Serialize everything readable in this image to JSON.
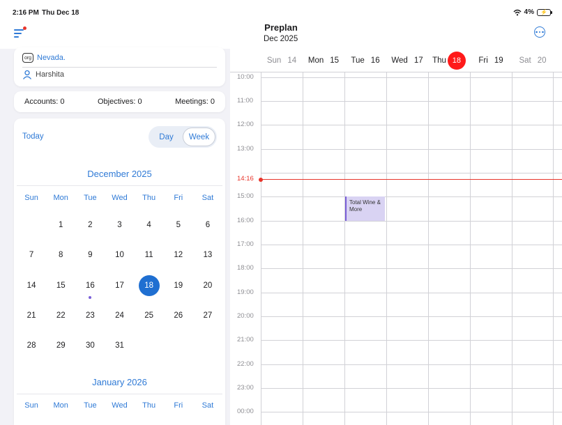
{
  "status": {
    "time": "2:16 PM",
    "date": "Thu Dec 18",
    "battery": "4%"
  },
  "nav": {
    "title": "Preplan",
    "subtitle": "Dec 2025"
  },
  "info": {
    "org": "Nevada.",
    "user": "Harshita",
    "org_icon_text": "org"
  },
  "stats": {
    "accounts": "Accounts: 0",
    "objectives": "Objectives: 0",
    "meetings": "Meetings: 0"
  },
  "calendar": {
    "today_label": "Today",
    "segment": {
      "day": "Day",
      "week": "Week",
      "selected": "Week"
    },
    "weekdays": [
      "Sun",
      "Mon",
      "Tue",
      "Wed",
      "Thu",
      "Fri",
      "Sat"
    ],
    "month1": {
      "title": "December 2025",
      "weeks": [
        [
          "",
          "1",
          "2",
          "3",
          "4",
          "5",
          "6"
        ],
        [
          "7",
          "8",
          "9",
          "10",
          "11",
          "12",
          "13"
        ],
        [
          "14",
          "15",
          "16",
          "17",
          "18",
          "19",
          "20"
        ],
        [
          "21",
          "22",
          "23",
          "24",
          "25",
          "26",
          "27"
        ],
        [
          "28",
          "29",
          "30",
          "31",
          "",
          "",
          ""
        ]
      ],
      "selected_day": "18",
      "event_days": [
        "16"
      ]
    },
    "month2": {
      "title": "January 2026"
    }
  },
  "week_view": {
    "days": [
      {
        "name": "Sun",
        "num": "14",
        "muted": true
      },
      {
        "name": "Mon",
        "num": "15",
        "muted": false
      },
      {
        "name": "Tue",
        "num": "16",
        "muted": false
      },
      {
        "name": "Wed",
        "num": "17",
        "muted": false
      },
      {
        "name": "Thu",
        "num": "18",
        "muted": false,
        "today": true
      },
      {
        "name": "Fri",
        "num": "19",
        "muted": false
      },
      {
        "name": "Sat",
        "num": "20",
        "muted": true
      }
    ],
    "hours": [
      "10:00",
      "11:00",
      "12:00",
      "13:00",
      "15:00",
      "16:00",
      "17:00",
      "18:00",
      "19:00",
      "20:00",
      "21:00",
      "22:00",
      "23:00",
      "00:00"
    ],
    "now_label": "14:16",
    "event": {
      "title": "Total Wine & More",
      "day": "Tue",
      "start": "15:00",
      "end": "16:00"
    }
  },
  "colors": {
    "accent": "#2f7ad6",
    "today": "#ff1a1a",
    "now_line": "#e8352b",
    "event_bg": "#d9d3f3",
    "event_border": "#7a5fd8"
  }
}
